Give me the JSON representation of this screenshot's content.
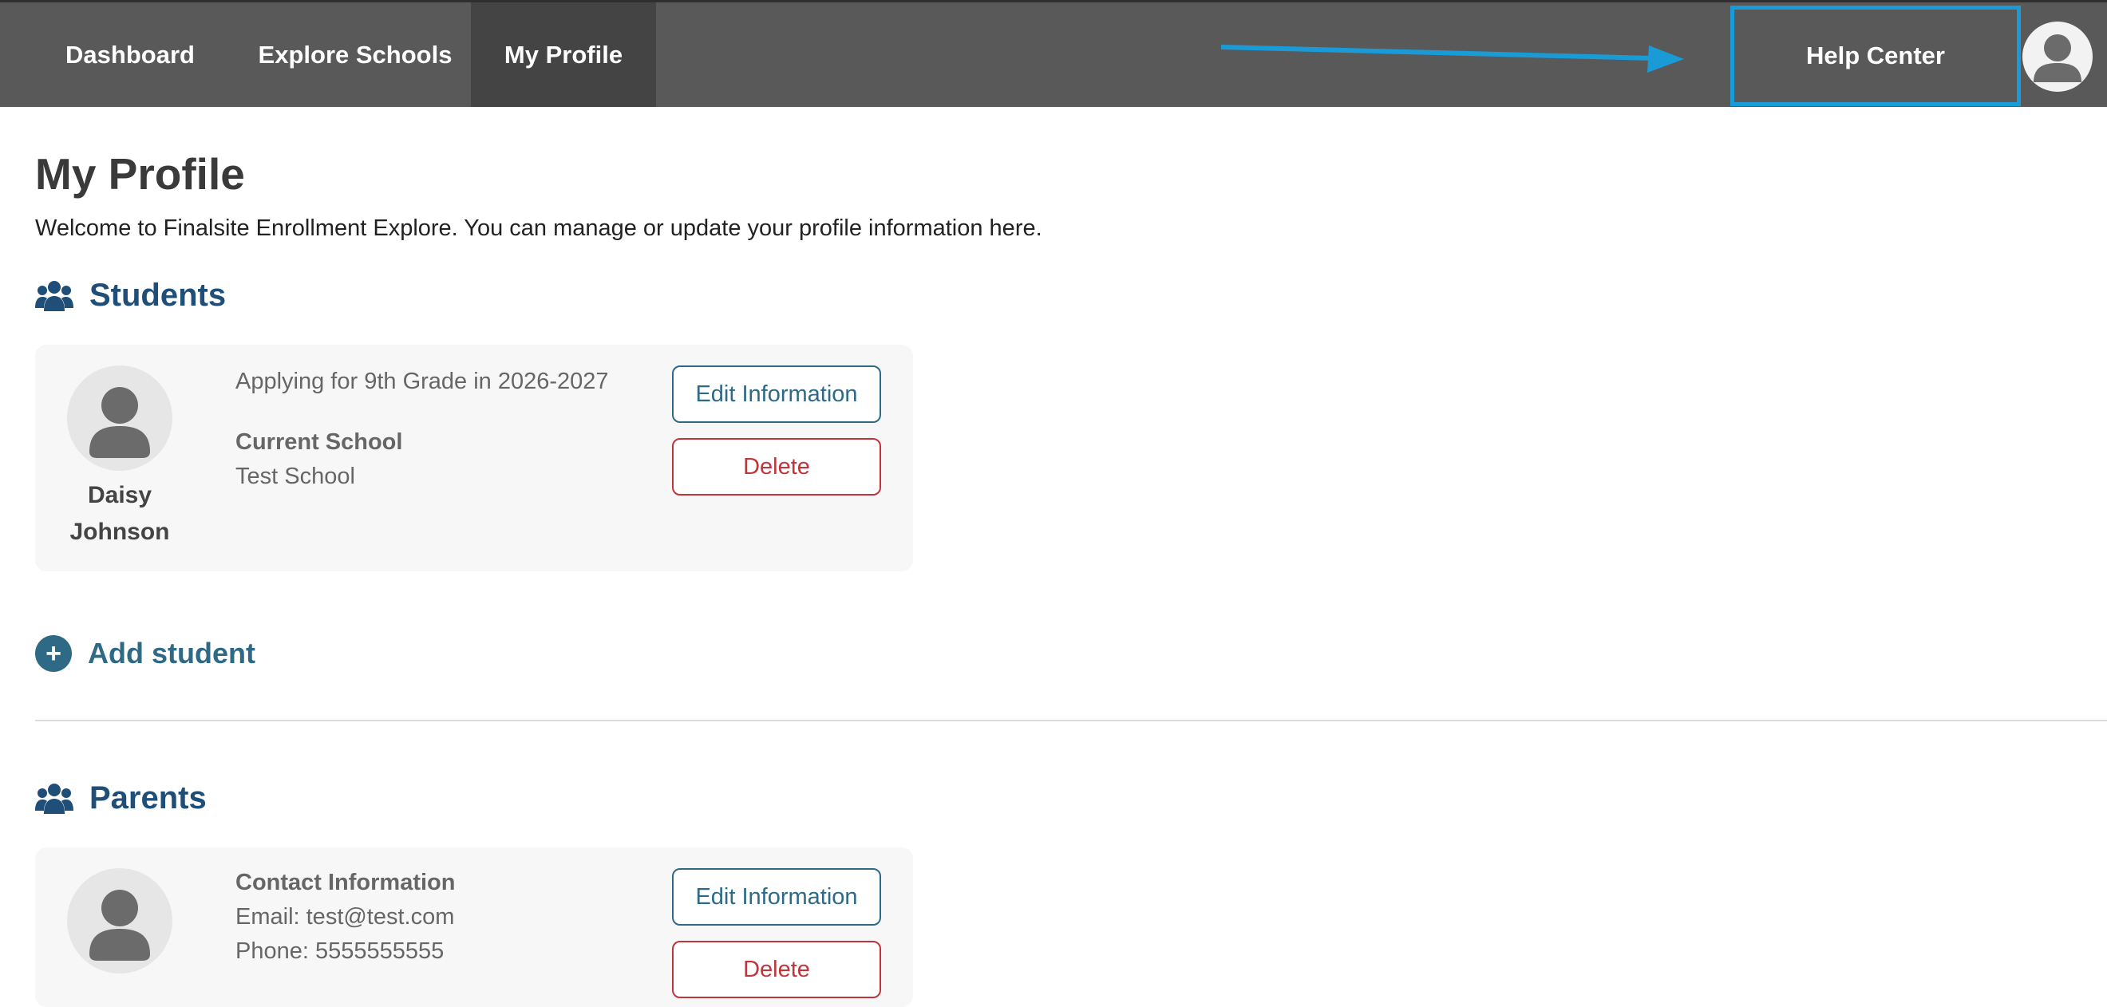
{
  "nav": {
    "items": [
      {
        "label": "Dashboard"
      },
      {
        "label": "Explore Schools"
      },
      {
        "label": "My Profile"
      }
    ],
    "help_center": "Help Center",
    "active": "My Profile"
  },
  "page": {
    "title": "My Profile",
    "intro": "Welcome to Finalsite Enrollment Explore. You can manage or update your profile information here."
  },
  "students": {
    "heading": "Students",
    "cards": [
      {
        "first_name": "Daisy",
        "last_name": "Johnson",
        "applying": "Applying for 9th Grade in 2026-2027",
        "current_school_label": "Current School",
        "current_school": "Test School",
        "edit_label": "Edit Information",
        "delete_label": "Delete"
      }
    ],
    "add_label": "Add student",
    "add_icon": "+"
  },
  "parents": {
    "heading": "Parents",
    "cards": [
      {
        "contact_label": "Contact Information",
        "email": "Email: test@test.com",
        "phone": "Phone: 5555555555",
        "edit_label": "Edit Information",
        "delete_label": "Delete"
      }
    ]
  },
  "icons": {
    "people": "people-group-icon",
    "avatar": "user-avatar-icon",
    "add": "plus-circle-icon",
    "annotation_arrow": "arrow-right-icon"
  },
  "colors": {
    "nav_bg": "#595959",
    "nav_active_bg": "#444444",
    "highlight_blue": "#1a9bd7",
    "heading_blue": "#1f4e79",
    "teal": "#2e6a86",
    "delete_red": "#c0343b"
  }
}
